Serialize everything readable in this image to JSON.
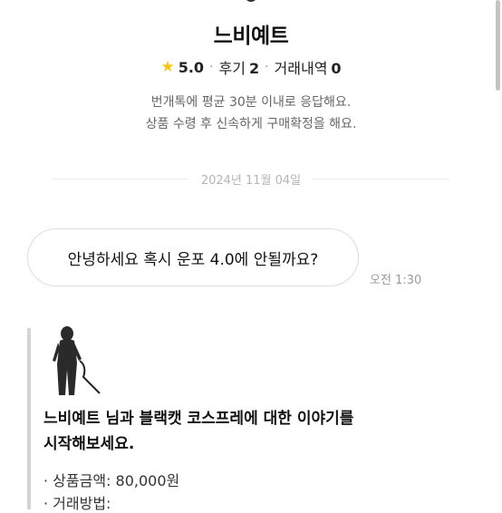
{
  "seller": {
    "name": "느비예트",
    "rating": "5.0",
    "reviews_label": "후기",
    "reviews_count": "2",
    "transactions_label": "거래내역",
    "transactions_count": "0",
    "notice_line1": "번개톡에 평균 30분 이내로 응답해요.",
    "notice_line2": "상품 수령 후 신속하게 구매확정을 해요."
  },
  "chat": {
    "date": "2024년 11월 04일",
    "messages": [
      {
        "text": "안녕하세요 혹시 운포 4.0에 안될까요?",
        "time": "오전 1:30"
      }
    ]
  },
  "product_card": {
    "title_line1": "느비예트 님과 블랙캣 코스프레에 대한 이야기를",
    "title_line2": "시작해보세요.",
    "price_line": "· 상품금액: 80,000원",
    "method_line": "· 거래방법:"
  },
  "icons": {
    "rating": "star-icon",
    "separator": "dot"
  },
  "colors": {
    "star": "#f5c518",
    "muted": "#666666",
    "date": "#b5b5b5",
    "bubble_border": "#dcdcdc"
  }
}
